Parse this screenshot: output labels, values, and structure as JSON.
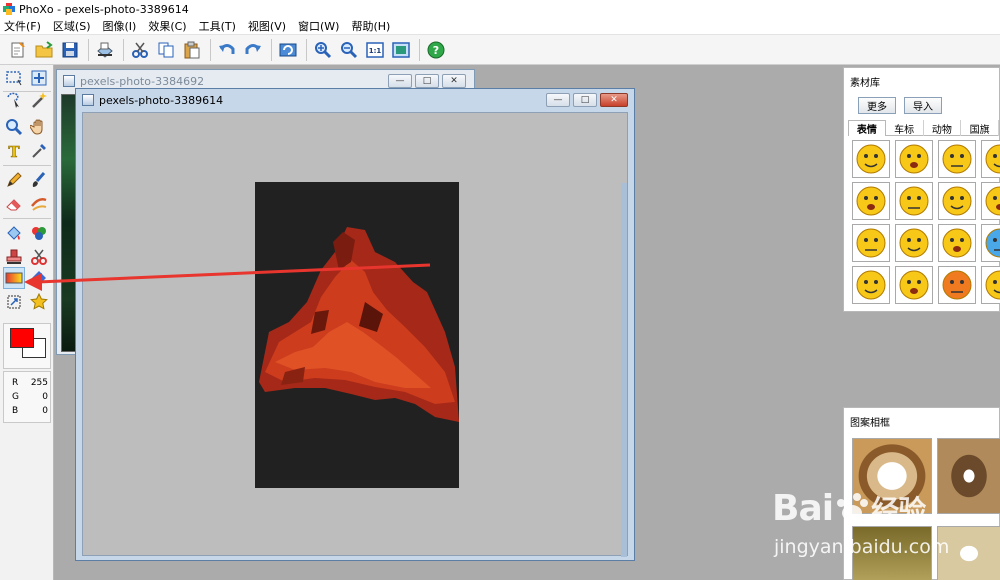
{
  "window": {
    "title": "PhoXo - pexels-photo-3389614"
  },
  "menu": [
    "文件(F)",
    "区域(S)",
    "图像(I)",
    "效果(C)",
    "工具(T)",
    "视图(V)",
    "窗口(W)",
    "帮助(H)"
  ],
  "toolbar": {
    "groups": [
      [
        "new-icon",
        "open-icon",
        "save-icon"
      ],
      [
        "scan-icon"
      ],
      [
        "cut-icon",
        "copy-icon",
        "paste-icon"
      ],
      [
        "undo-icon",
        "redo-icon"
      ],
      [
        "refresh-icon"
      ],
      [
        "zoom-in-icon",
        "zoom-out-icon",
        "actual-size-icon",
        "fit-window-icon"
      ],
      [
        "help-icon"
      ]
    ],
    "actual_size_label": "1:1"
  },
  "tools": [
    "rect-select-icon",
    "move-icon",
    "lasso-icon",
    "magic-wand-icon",
    "zoom-icon",
    "hand-icon",
    "text-icon",
    "eyedropper-icon",
    "pencil-icon",
    "brush-icon",
    "eraser-icon",
    "smudge-icon",
    "fill-icon",
    "color-replace-icon",
    "stamp-icon",
    "scissors-icon",
    "gradient-icon",
    "shape-icon",
    "transform-icon",
    "star-icon"
  ],
  "colors": {
    "foreground": "#ff0000",
    "background": "#ffffff",
    "accent": "#e8352e",
    "image_bg": "#212121",
    "mountain": "#c0301a"
  },
  "rgb": {
    "r_label": "R",
    "r": "255",
    "g_label": "G",
    "g": "0",
    "b_label": "B",
    "b": "0"
  },
  "documents": {
    "back": {
      "title": "pexels-photo-3384692"
    },
    "front": {
      "title": "pexels-photo-3389614"
    }
  },
  "material_panel": {
    "title": "素材库",
    "more_button": "更多",
    "import_button": "导入",
    "tabs": [
      "表情",
      "车标",
      "动物",
      "国旗"
    ],
    "active_tab": 0
  },
  "frame_panel": {
    "title": "图案相框"
  },
  "watermark": {
    "brand": "Bai",
    "brand2": "经验",
    "url": "jingyan.baidu.com"
  }
}
